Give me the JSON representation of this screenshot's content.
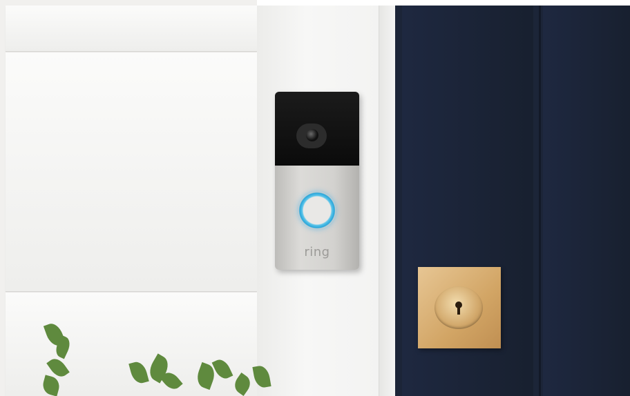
{
  "scene": {
    "subject": "video-doorbell",
    "brand_logo": "ring",
    "colors": {
      "siding": "#f1f0ee",
      "trim": "#f4f4f3",
      "door": "#1c2538",
      "doorbell_face": "#d3d2cf",
      "camera_band": "#111111",
      "button_ring": "#2aa6da",
      "lock_brass": "#d2a565",
      "foliage": "#5f8a3e"
    }
  }
}
